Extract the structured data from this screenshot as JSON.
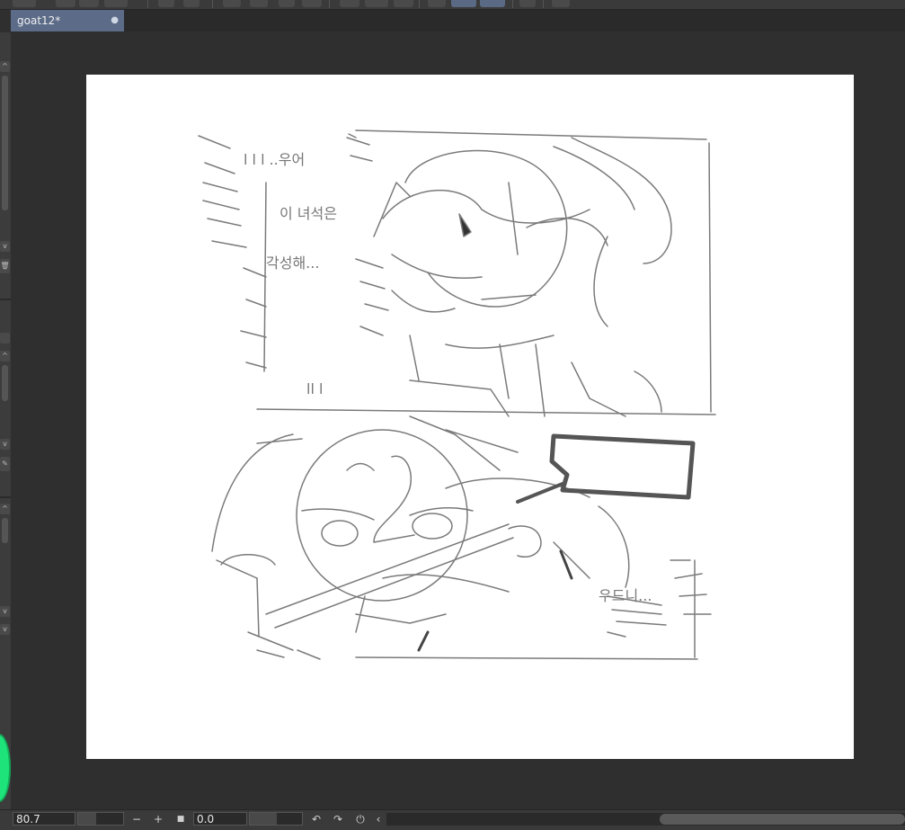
{
  "document_tab": {
    "title": "goat12*",
    "close_glyph": "●"
  },
  "statusbar": {
    "zoom_value": "80.7",
    "zoom_out_label": "−",
    "zoom_in_label": "+",
    "fit_label": "■",
    "rotation_value": "0.0",
    "rotate_left_glyph": "↶",
    "rotate_right_glyph": "↷",
    "reset_glyph": "⏻",
    "scroll_left_glyph": "‹"
  },
  "left_strip": {
    "up_glyph": "^",
    "down_glyph": "v",
    "trash_glyph": "🗑",
    "brush_glyph": "✎"
  },
  "colors": {
    "tab_active": "#5b6b88",
    "canvas_bg": "#2f2f2f",
    "paper": "#ffffff",
    "sketch_stroke": "#7a7a7a",
    "color_wheel": "#1ee27a"
  },
  "sketch_text": {
    "line1": "l l l ..우어",
    "line2": "이 녀석은",
    "line3": "각성해...",
    "line4": "ll l",
    "line5": "우드니..."
  }
}
